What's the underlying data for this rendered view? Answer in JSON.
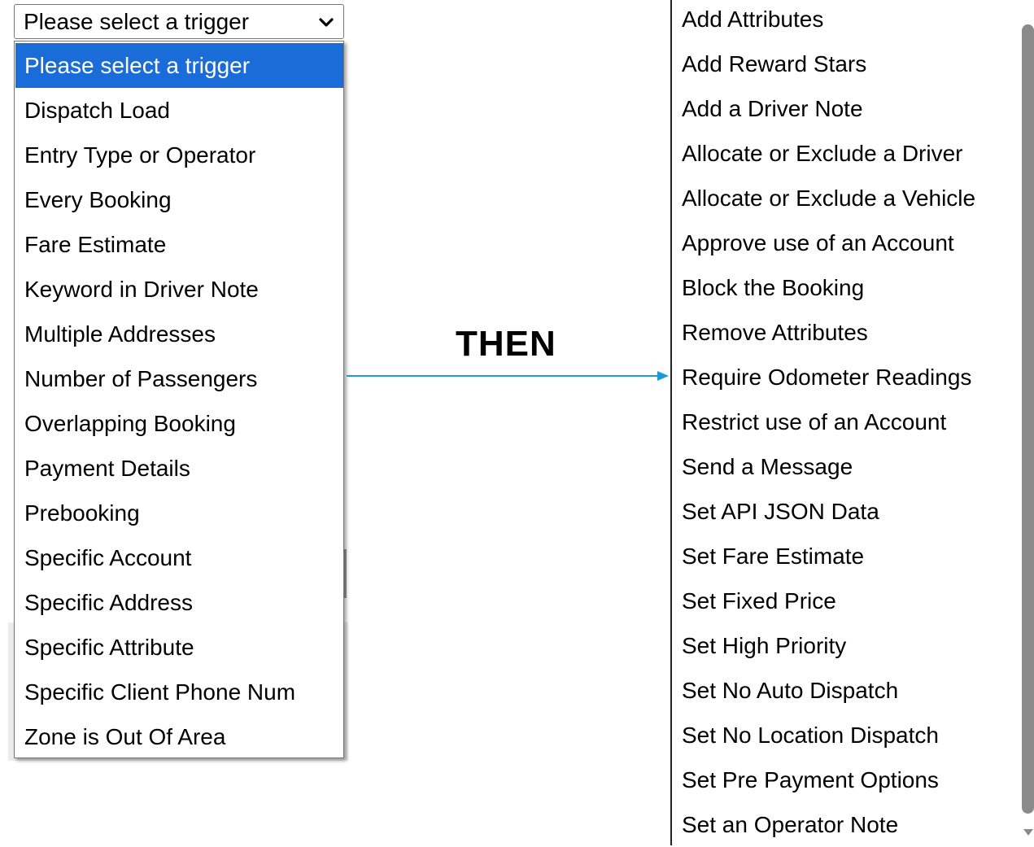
{
  "trigger_select": {
    "selected_value": "Please select a trigger",
    "options": [
      "Please select a trigger",
      "Dispatch Load",
      "Entry Type or Operator",
      "Every Booking",
      "Fare Estimate",
      "Keyword in Driver Note",
      "Multiple Addresses",
      "Number of Passengers",
      "Overlapping Booking",
      "Payment Details",
      "Prebooking",
      "Specific Account",
      "Specific Address",
      "Specific Attribute",
      "Specific Client Phone Num",
      "Zone is Out Of Area"
    ]
  },
  "connector": {
    "label": "THEN",
    "arrow_color": "#1e9ad6"
  },
  "actions": {
    "items": [
      "Add Attributes",
      "Add Reward Stars",
      "Add a Driver Note",
      "Allocate or Exclude a Driver",
      "Allocate or Exclude a Vehicle",
      "Approve use of an Account",
      "Block the Booking",
      "Remove Attributes",
      "Require Odometer Readings",
      "Restrict use of an Account",
      "Send a Message",
      "Set API JSON Data",
      "Set Fare Estimate",
      "Set Fixed Price",
      "Set High Priority",
      "Set No Auto Dispatch",
      "Set No Location Dispatch",
      "Set Pre Payment Options",
      "Set an Operator Note"
    ]
  },
  "colors": {
    "selected_option_bg": "#1a6dd8",
    "selected_option_text": "#ffffff"
  }
}
